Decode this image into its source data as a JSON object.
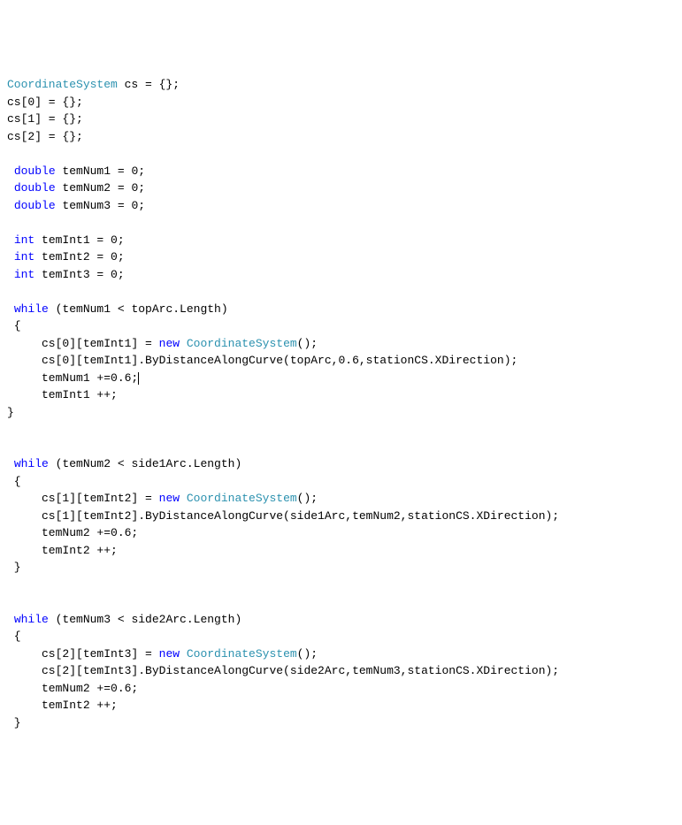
{
  "line1": {
    "type": "CoordinateSystem",
    "rest": " cs = {};"
  },
  "line2": "cs[0] = {};",
  "line3": "cs[1] = {};",
  "line4": "cs[2] = {};",
  "decl1": {
    "kw": "double",
    "rest": " temNum1 = 0;"
  },
  "decl2": {
    "kw": "double",
    "rest": " temNum2 = 0;"
  },
  "decl3": {
    "kw": "double",
    "rest": " temNum3 = 0;"
  },
  "decl4": {
    "kw": "int",
    "rest": " temInt1 = 0;"
  },
  "decl5": {
    "kw": "int",
    "rest": " temInt2 = 0;"
  },
  "decl6": {
    "kw": "int",
    "rest": " temInt3 = 0;"
  },
  "while1": {
    "kw": "while",
    "cond": " (temNum1 < topArc.Length)"
  },
  "w1_l1a": "     cs[0][temInt1] = ",
  "w1_l1_new": "new",
  "w1_l1_type": " CoordinateSystem",
  "w1_l1b": "();",
  "w1_l2": "     cs[0][temInt1].ByDistanceAlongCurve(topArc,0.6,stationCS.XDirection);",
  "w1_l3": "     temNum1 +=0.6;",
  "w1_l4": "     temInt1 ++;",
  "while2": {
    "kw": "while",
    "cond": " (temNum2 < side1Arc.Length)"
  },
  "w2_l1a": "     cs[1][temInt2] = ",
  "w2_l1_new": "new",
  "w2_l1_type": " CoordinateSystem",
  "w2_l1b": "();",
  "w2_l2": "     cs[1][temInt2].ByDistanceAlongCurve(side1Arc,temNum2,stationCS.XDirection);",
  "w2_l3": "     temNum2 +=0.6;",
  "w2_l4": "     temInt2 ++;",
  "while3": {
    "kw": "while",
    "cond": " (temNum3 < side2Arc.Length)"
  },
  "w3_l1a": "     cs[2][temInt3] = ",
  "w3_l1_new": "new",
  "w3_l1_type": " CoordinateSystem",
  "w3_l1b": "();",
  "w3_l2": "     cs[2][temInt3].ByDistanceAlongCurve(side2Arc,temNum3,stationCS.XDirection);",
  "w3_l3": "     temNum2 +=0.6;",
  "w3_l4": "     temInt2 ++;",
  "brace_open": " {",
  "brace_close": " }",
  "brace_close_outer": "}"
}
